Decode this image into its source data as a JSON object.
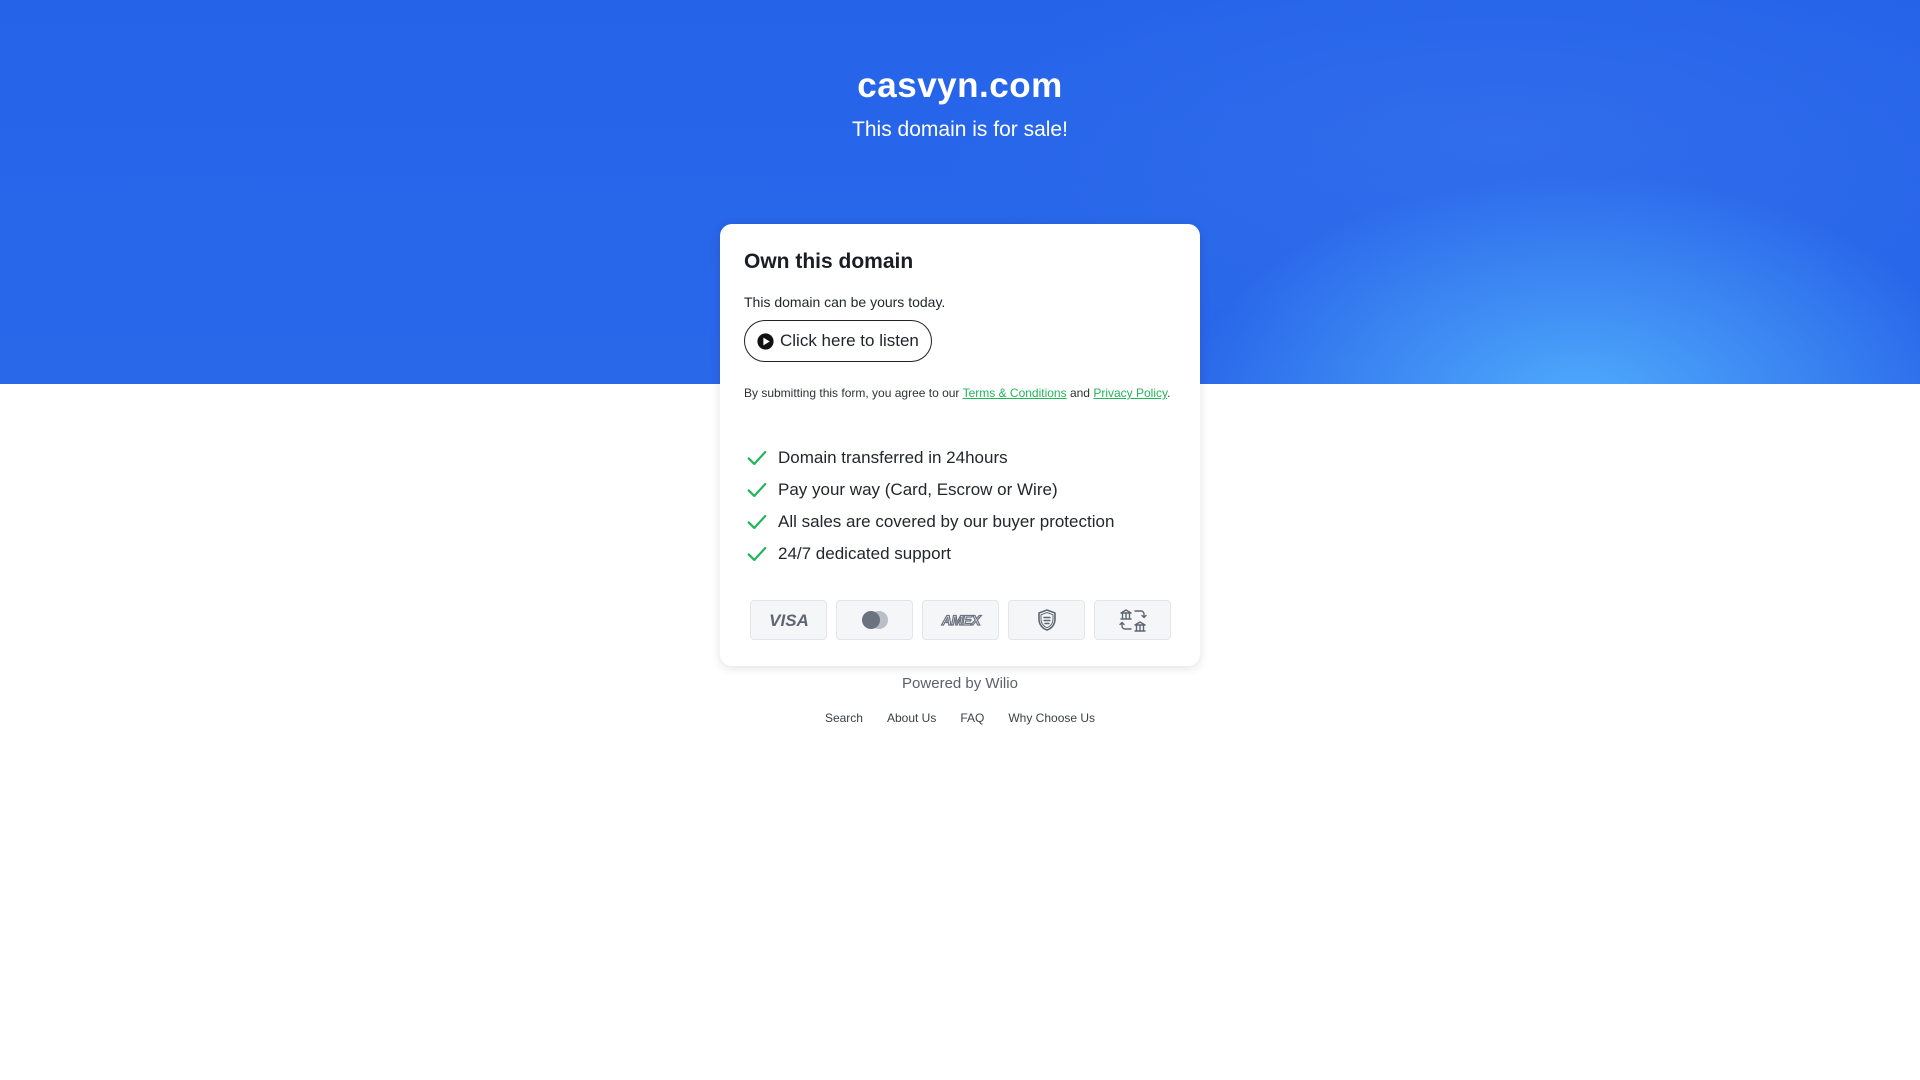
{
  "hero": {
    "domain": "casvyn.com",
    "tagline": "This domain is for sale!"
  },
  "card": {
    "title": "Own this domain",
    "text": "This domain can be yours today.",
    "listen_label": "Click here to listen",
    "terms_prefix": "By submitting this form, you agree to our ",
    "terms_link": "Terms & Conditions",
    "terms_and": " and ",
    "privacy_link": "Privacy Policy",
    "terms_suffix": ".",
    "features": [
      "Domain transferred in 24hours",
      "Pay your way (Card, Escrow or Wire)",
      "All sales are covered by our buyer protection",
      "24/7 dedicated support"
    ],
    "payments": [
      {
        "icon": "visa-icon",
        "label": "VISA"
      },
      {
        "icon": "mastercard-icon",
        "label": ""
      },
      {
        "icon": "amex-icon",
        "label": "AMEX"
      },
      {
        "icon": "escrow-shield-icon",
        "label": ""
      },
      {
        "icon": "bank-transfer-icon",
        "label": ""
      }
    ]
  },
  "footer": {
    "powered": "Powered by Wilio",
    "links": [
      "Search",
      "About Us",
      "FAQ",
      "Why Choose Us"
    ]
  },
  "colors": {
    "hero_blue": "#2563e9",
    "hero_glow": "#56b6ff",
    "accent_green": "#21b55a",
    "badge_icon_gray": "#5f6673"
  }
}
